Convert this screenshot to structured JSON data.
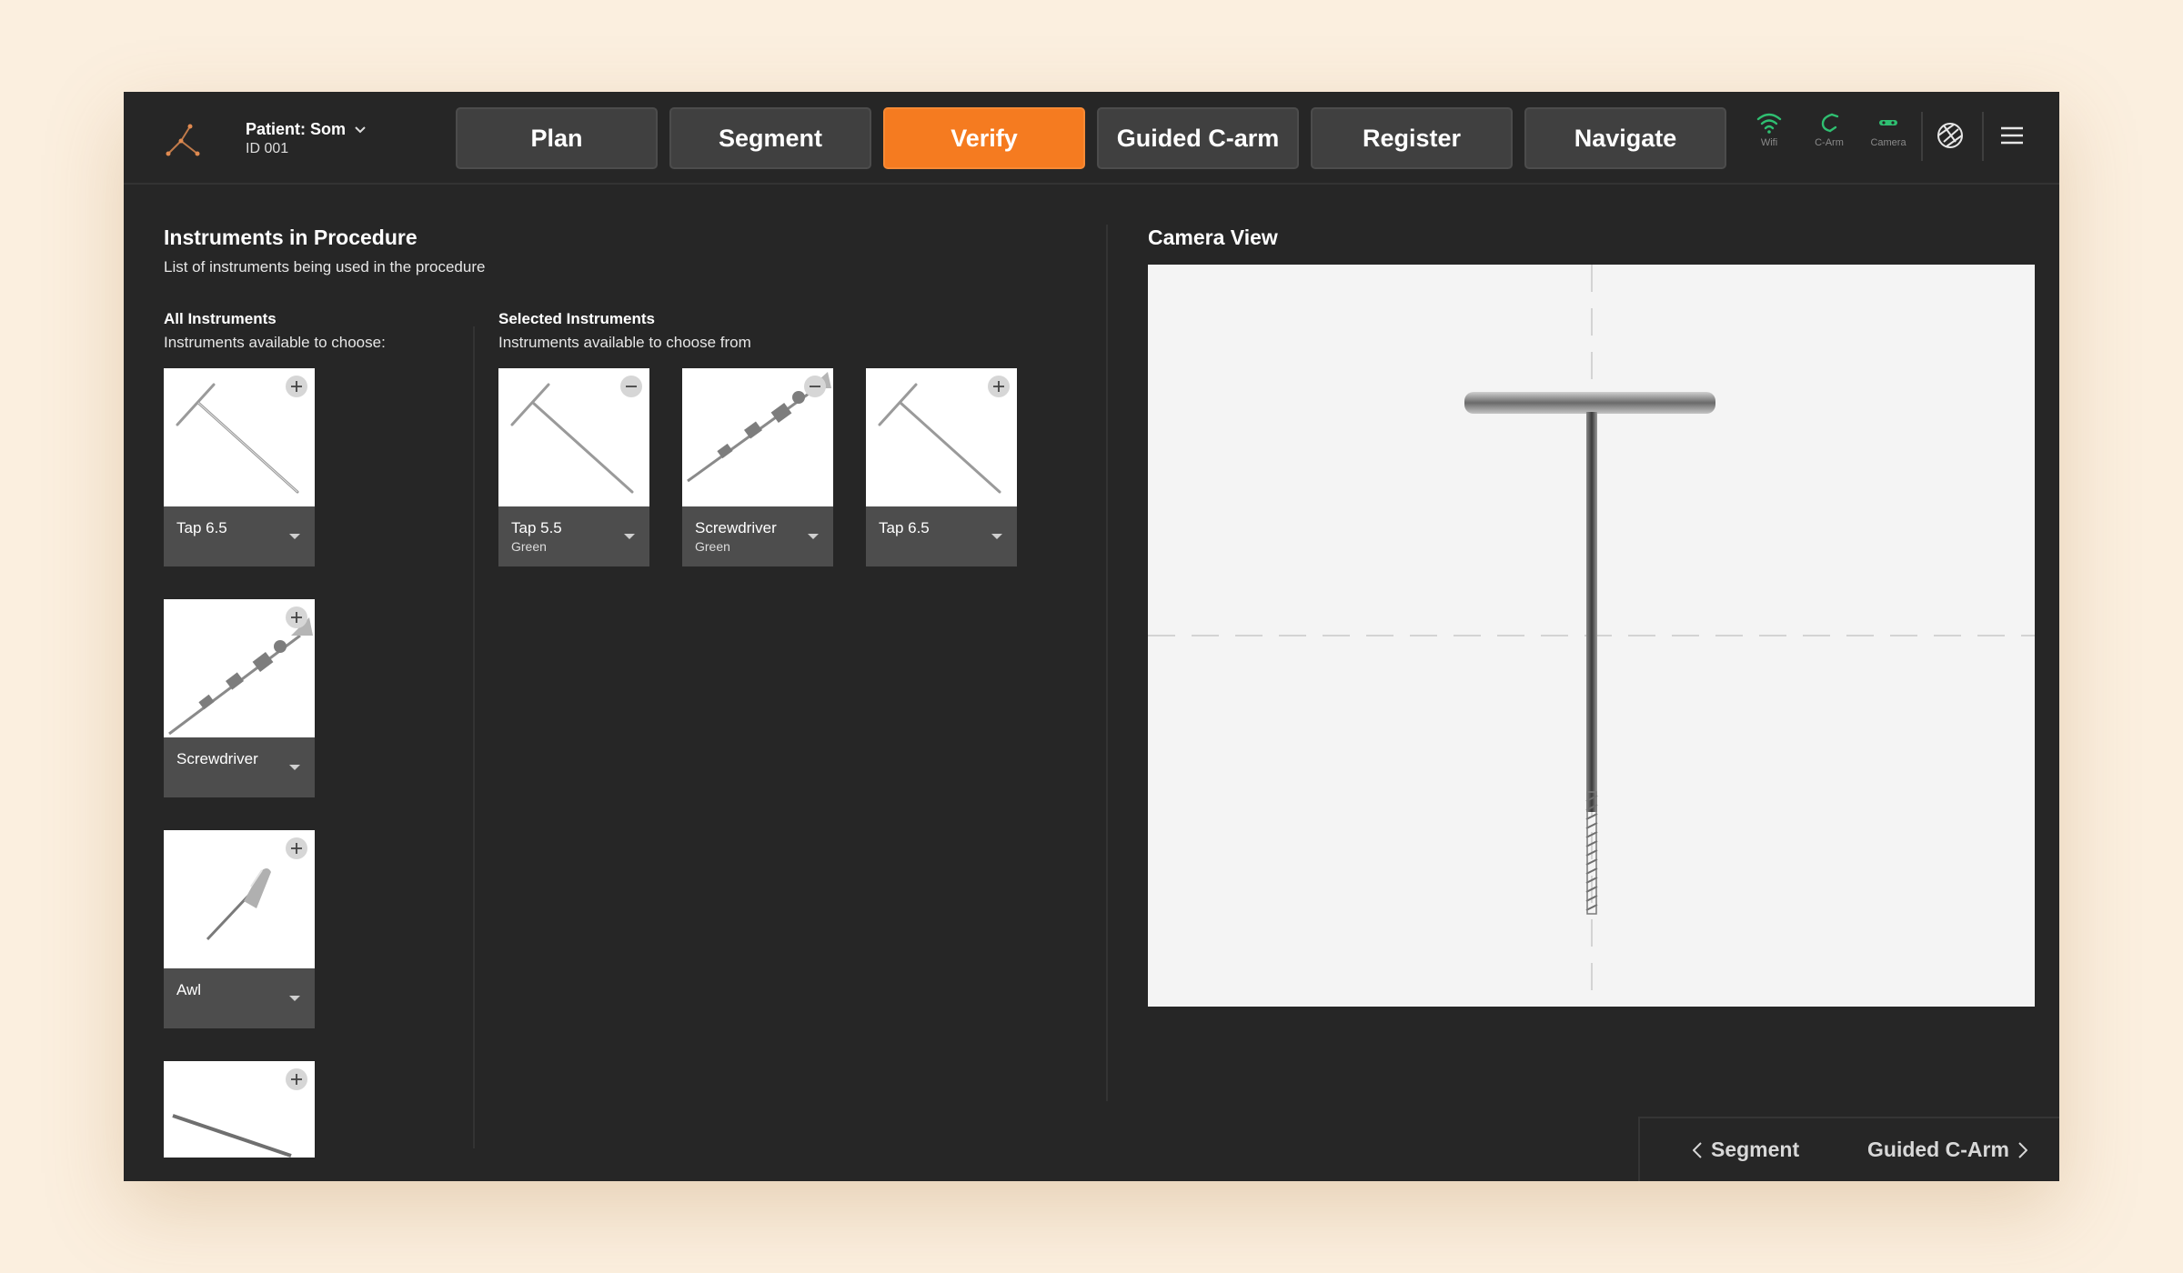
{
  "header": {
    "patient_name": "Patient: Som",
    "patient_id": "ID 001",
    "tabs": [
      {
        "label": "Plan",
        "active": false
      },
      {
        "label": "Segment",
        "active": false
      },
      {
        "label": "Verify",
        "active": true
      },
      {
        "label": "Guided C-arm",
        "active": false
      },
      {
        "label": "Register",
        "active": false
      },
      {
        "label": "Navigate",
        "active": false
      }
    ],
    "status": {
      "wifi": "Wifi",
      "carm": "C-Arm",
      "camera": "Camera"
    }
  },
  "instruments": {
    "title": "Instruments in Procedure",
    "subtitle": "List of instruments being used in the procedure",
    "all": {
      "title": "All Instruments",
      "subtitle": "Instruments available to choose:",
      "items": [
        {
          "name": "Tap 6.5",
          "icon": "tap-icon"
        },
        {
          "name": "Screwdriver",
          "icon": "screwdriver-icon"
        },
        {
          "name": "Awl",
          "icon": "awl-icon"
        },
        {
          "name": "",
          "icon": "probe-icon"
        }
      ]
    },
    "selected": {
      "title": "Selected Instruments",
      "subtitle": "Instruments available to choose from",
      "items": [
        {
          "name": "Tap 5.5",
          "color": "Green",
          "icon": "tap-icon"
        },
        {
          "name": "Screwdriver",
          "color": "Green",
          "icon": "screwdriver-icon"
        },
        {
          "name": "Tap 6.5",
          "color": "",
          "icon": "tap-icon"
        }
      ]
    }
  },
  "camera": {
    "title": "Camera View"
  },
  "footer": {
    "prev_label": "Segment",
    "next_label": "Guided C-Arm"
  },
  "colors": {
    "accent": "#f57b20",
    "status_green": "#2fbf71",
    "panel": "#262626"
  }
}
